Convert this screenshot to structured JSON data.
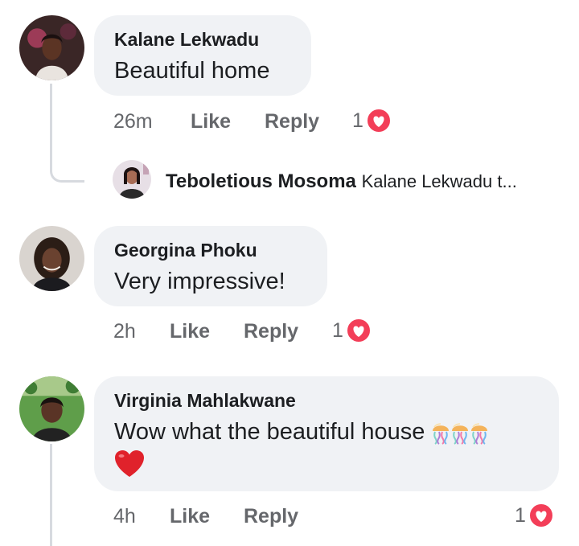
{
  "colors": {
    "bubble_bg": "#f0f2f5",
    "text_primary": "#1c1e21",
    "text_secondary": "#65676b",
    "reaction_red": "#f33e58",
    "thread_line": "#d7dadf"
  },
  "comments": [
    {
      "author": "Kalane Lekwadu",
      "text": "Beautiful home",
      "time": "26m",
      "like_label": "Like",
      "reply_label": "Reply",
      "reaction_count": "1",
      "reaction_icon": "heart-reaction-icon",
      "reply_preview": {
        "author": "Teboletious Mosoma",
        "snippet": "Kalane Lekwadu t..."
      }
    },
    {
      "author": "Georgina Phoku",
      "text": "Very impressive!",
      "time": "2h",
      "like_label": "Like",
      "reply_label": "Reply",
      "reaction_count": "1",
      "reaction_icon": "heart-reaction-icon"
    },
    {
      "author": "Virginia Mahlakwane",
      "text": "Wow what the beautiful house",
      "emoji": [
        "jellyfish-icon",
        "jellyfish-icon",
        "jellyfish-icon",
        "red-heart-emoji-icon"
      ],
      "time": "4h",
      "like_label": "Like",
      "reply_label": "Reply",
      "reaction_count": "1",
      "reaction_icon": "heart-reaction-icon"
    }
  ]
}
